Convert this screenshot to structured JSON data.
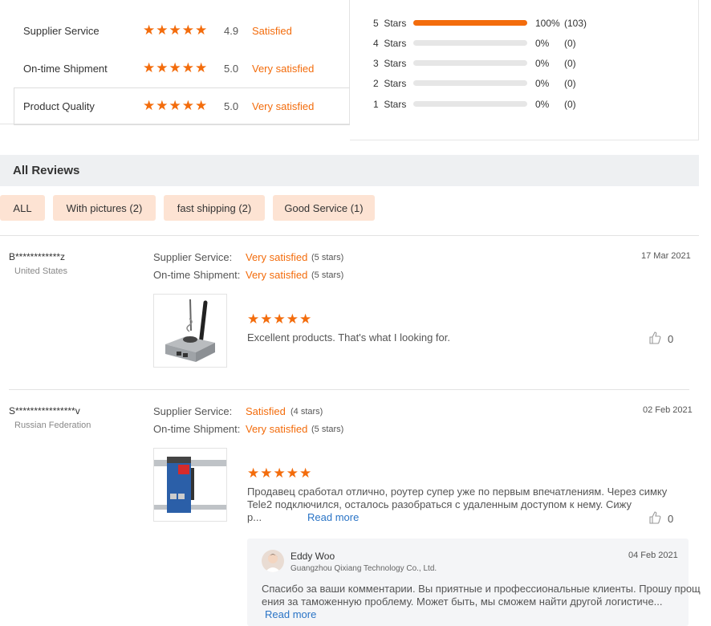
{
  "summary": {
    "ratings": [
      {
        "label": "Supplier Service",
        "score": "4.9",
        "status": "Satisfied"
      },
      {
        "label": "On-time Shipment",
        "score": "5.0",
        "status": "Very satisfied"
      },
      {
        "label": "Product Quality",
        "score": "5.0",
        "status": "Very satisfied"
      }
    ],
    "stars_glyph": "★★★★★",
    "distribution": [
      {
        "label": "5  Stars",
        "percent": "100%",
        "count": "(103)",
        "fill": 1.0
      },
      {
        "label": "4  Stars",
        "percent": "0%",
        "count": "(0)",
        "fill": 0
      },
      {
        "label": "3  Stars",
        "percent": "0%",
        "count": "(0)",
        "fill": 0
      },
      {
        "label": "2  Stars",
        "percent": "0%",
        "count": "(0)",
        "fill": 0
      },
      {
        "label": "1  Stars",
        "percent": "0%",
        "count": "(0)",
        "fill": 0
      }
    ]
  },
  "all_reviews_title": "All Reviews",
  "filters": [
    "ALL",
    "With pictures (2)",
    "fast shipping (2)",
    "Good Service (1)"
  ],
  "reviews": [
    {
      "name": "B************z",
      "country": "United States",
      "supplier_label": "Supplier Service:",
      "supplier_value": "Very satisfied",
      "supplier_stars": "(5 stars)",
      "shipment_label": "On-time Shipment:",
      "shipment_value": "Very satisfied",
      "shipment_stars": "(5 stars)",
      "date": "17 Mar 2021",
      "stars": "★★★★★",
      "text": "Excellent products. That's what I looking for.",
      "likes": "0"
    },
    {
      "name": "S****************v",
      "country": "Russian Federation",
      "supplier_label": "Supplier Service:",
      "supplier_value": "Satisfied",
      "supplier_stars": "(4 stars)",
      "shipment_label": "On-time Shipment:",
      "shipment_value": "Very satisfied",
      "shipment_stars": "(5 stars)",
      "date": "02 Feb 2021",
      "stars": "★★★★★",
      "text_line1": "Продавец сработал отлично, роутер супер уже по первым впечатлениям. Через симку",
      "text_line2": "Tele2 подключился, осталось разобраться с удаленным доступом к нему. Сижу",
      "text_line3": "р...",
      "read_more": "Read more",
      "likes": "0",
      "reply": {
        "name": "Eddy Woo",
        "company": "Guangzhou Qixiang Technology Co., Ltd.",
        "date": "04 Feb 2021",
        "line1": "Спасибо за ваши комментарии. Вы приятные и профессиональные клиенты. Прошу прощ",
        "line2": "ения за таможенную проблему. Может быть, мы сможем найти другой логистиче...",
        "read_more": "Read more"
      }
    }
  ]
}
